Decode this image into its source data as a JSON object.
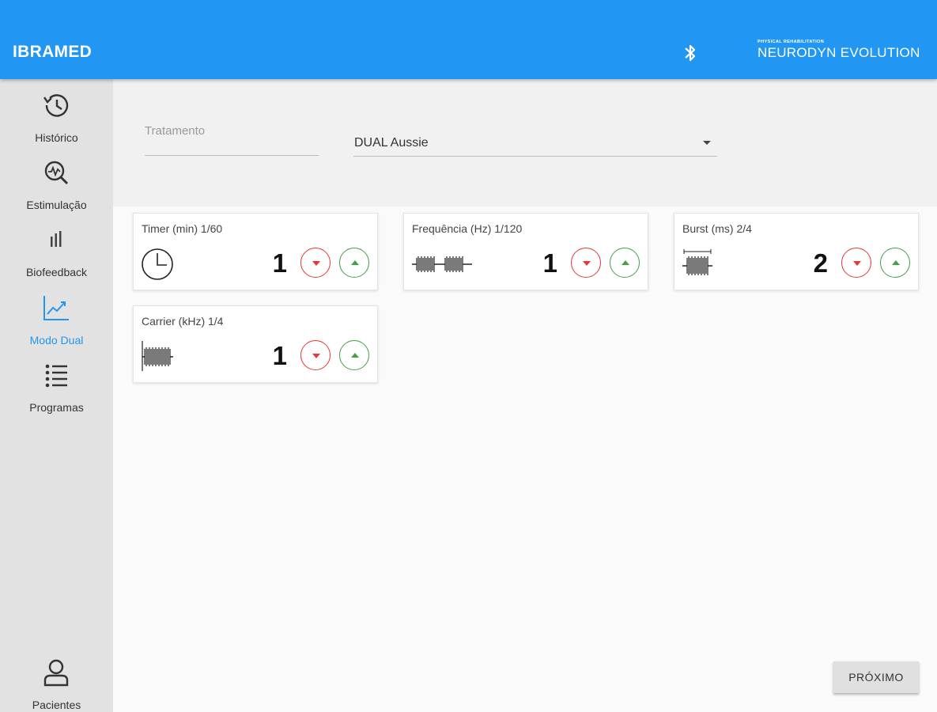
{
  "appbar": {
    "title": "IBRAMED",
    "brand_small": "PHYSICAL REHABILITATION",
    "brand_main": "NEURODYN EVOLUTION",
    "bluetooth_icon": "bluetooth-icon"
  },
  "sidebar": {
    "items": [
      {
        "label": "Histórico",
        "icon": "history-icon",
        "active": false
      },
      {
        "label": "Estimulação",
        "icon": "stimulation-search-icon",
        "active": false
      },
      {
        "label": "Biofeedback",
        "icon": "bar-chart-icon",
        "active": false
      },
      {
        "label": "Modo Dual",
        "icon": "trending-chart-icon",
        "active": true
      },
      {
        "label": "Programas",
        "icon": "list-icon",
        "active": false
      }
    ],
    "bottom_item": {
      "label": "Pacientes",
      "icon": "person-icon"
    }
  },
  "form": {
    "tratamento_label": "Tratamento",
    "tratamento_value": "",
    "program_select_value": "DUAL Aussie"
  },
  "cards": [
    {
      "label": "Timer (min) 1/60",
      "value": "1",
      "icon": "clock-icon"
    },
    {
      "label": "Frequência (Hz) 1/120",
      "value": "1",
      "icon": "frequency-wave-icon"
    },
    {
      "label": "Burst (ms) 2/4",
      "value": "2",
      "icon": "burst-wave-icon"
    },
    {
      "label": "Carrier (kHz) 1/4",
      "value": "1",
      "icon": "carrier-wave-icon"
    }
  ],
  "actions": {
    "next_label": "PRÓXIMO"
  },
  "colors": {
    "primary": "#2196f3",
    "decrement": "#e53935",
    "increment": "#43a047",
    "sidebar_bg": "#e2e2e2"
  }
}
